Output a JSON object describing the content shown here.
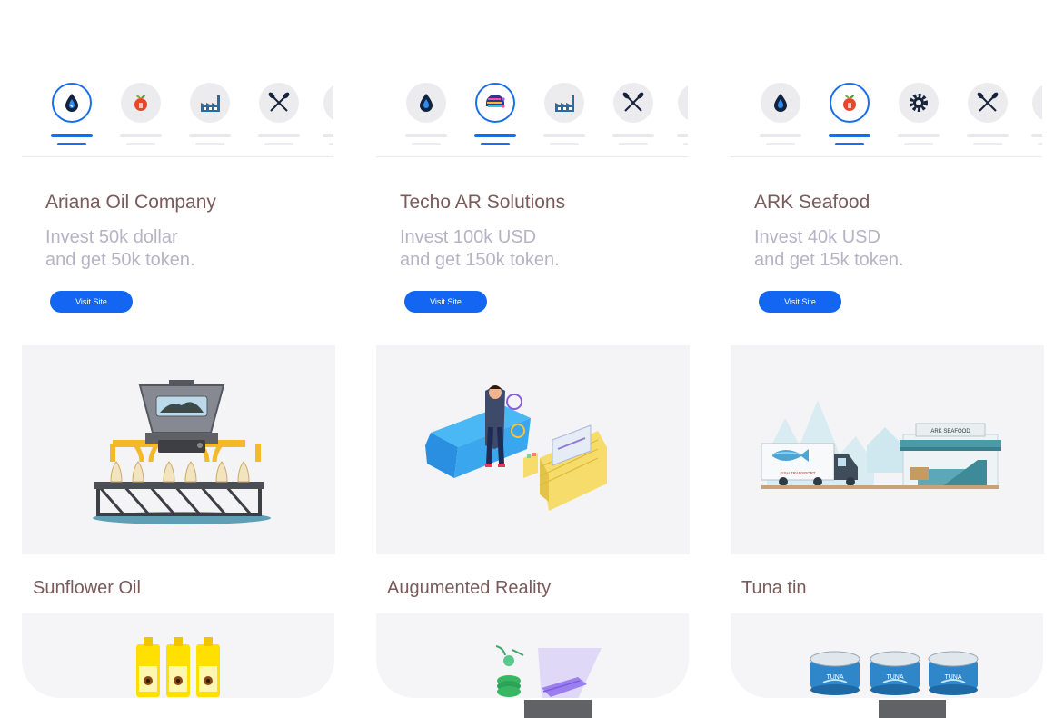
{
  "cards": [
    {
      "name": "Ariana Oil Company",
      "desc_line1": "Invest 50k dollar",
      "desc_line2": "and get 50k token.",
      "button": "Visit Site",
      "product": "Sunflower Oil",
      "tabs": [
        "oil-drop-icon",
        "fruit-basket-icon",
        "factory-icon",
        "crossed-oars-icon",
        "partial-icon"
      ],
      "active_tab": 0
    },
    {
      "name": "Techo AR Solutions",
      "desc_line1": "Invest 100k USD",
      "desc_line2": "and get 150k token.",
      "button": "Visit Site",
      "product": "Augumented Reality",
      "tabs": [
        "oil-drop-icon",
        "tech-brain-icon",
        "factory-icon",
        "crossed-oars-icon",
        "partial-icon"
      ],
      "active_tab": 1
    },
    {
      "name": "ARK Seafood",
      "desc_line1": "Invest 40k USD",
      "desc_line2": "and get 15k token.",
      "button": "Visit Site",
      "product": "Tuna tin",
      "tabs": [
        "oil-drop-icon",
        "fruit-basket-icon",
        "gear-icon",
        "crossed-oars-icon",
        "partial-icon"
      ],
      "active_tab": 1
    }
  ],
  "illustration_text": {
    "warehouse_sign": "ARK SEAFOOD",
    "truck_label": "FISH TRANSPORT",
    "tin_label": "TUNA"
  },
  "colors": {
    "accent": "#1266f1",
    "title_text": "#7a5a5a",
    "desc_text": "#b7b3c5",
    "panel_bg": "#f4f4f6"
  }
}
